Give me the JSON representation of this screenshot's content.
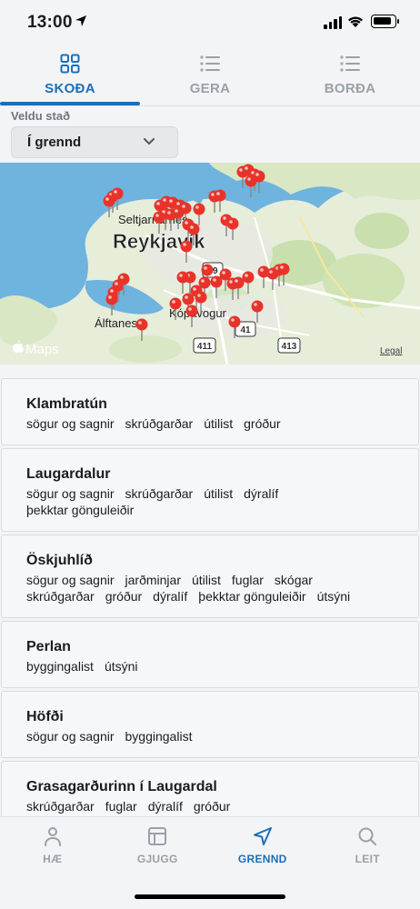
{
  "status_bar": {
    "time": "13:00"
  },
  "top_tabs": [
    {
      "label": "SKOÐA",
      "icon": "grid-icon",
      "active": true
    },
    {
      "label": "GERA",
      "icon": "list-icon",
      "active": false
    },
    {
      "label": "BORÐA",
      "icon": "list-icon",
      "active": false
    }
  ],
  "picker": {
    "label": "Veldu stað",
    "value": "Í grennd"
  },
  "map": {
    "labels": {
      "seltjarnarnes": "Seltjarnarnes",
      "reykjavik": "Reykjavík",
      "kopavogur": "Kópavogur",
      "alftanes": "Álftanes",
      "road_49": "49",
      "road_41": "41",
      "road_411": "411",
      "road_413": "413"
    },
    "attribution": "Maps",
    "legal": "Legal"
  },
  "places": [
    {
      "name": "Klambratún",
      "tags": [
        "sögur og sagnir",
        "skrúðgarðar",
        "útilist",
        "gróður"
      ]
    },
    {
      "name": "Laugardalur",
      "tags": [
        "sögur og sagnir",
        "skrúðgarðar",
        "útilist",
        "dýralíf",
        "þekktar gönguleiðir"
      ]
    },
    {
      "name": "Öskjuhlíð",
      "tags": [
        "sögur og sagnir",
        "jarðminjar",
        "útilist",
        "fuglar",
        "skógar",
        "skrúðgarðar",
        "gróður",
        "dýralíf",
        "þekktar gönguleiðir",
        "útsýni"
      ]
    },
    {
      "name": "Perlan",
      "tags": [
        "byggingalist",
        "útsýni"
      ]
    },
    {
      "name": "Höfði",
      "tags": [
        "sögur og sagnir",
        "byggingalist"
      ]
    },
    {
      "name": "Grasagarðurinn í Laugardal",
      "tags": [
        "skrúðgarðar",
        "fuglar",
        "dýralíf",
        "gróður"
      ]
    }
  ],
  "bottom_nav": [
    {
      "label": "HÆ",
      "icon": "person-icon",
      "active": false
    },
    {
      "label": "GJUGG",
      "icon": "layout-icon",
      "active": false
    },
    {
      "label": "GRENND",
      "icon": "navigation-arrow-icon",
      "active": true
    },
    {
      "label": "LEIT",
      "icon": "search-icon",
      "active": false
    }
  ],
  "colors": {
    "accent": "#1b6fb8",
    "inactive": "#9aa0a8",
    "pin": "#e8332a",
    "water": "#6fb3df",
    "land": "#e6edd9"
  }
}
